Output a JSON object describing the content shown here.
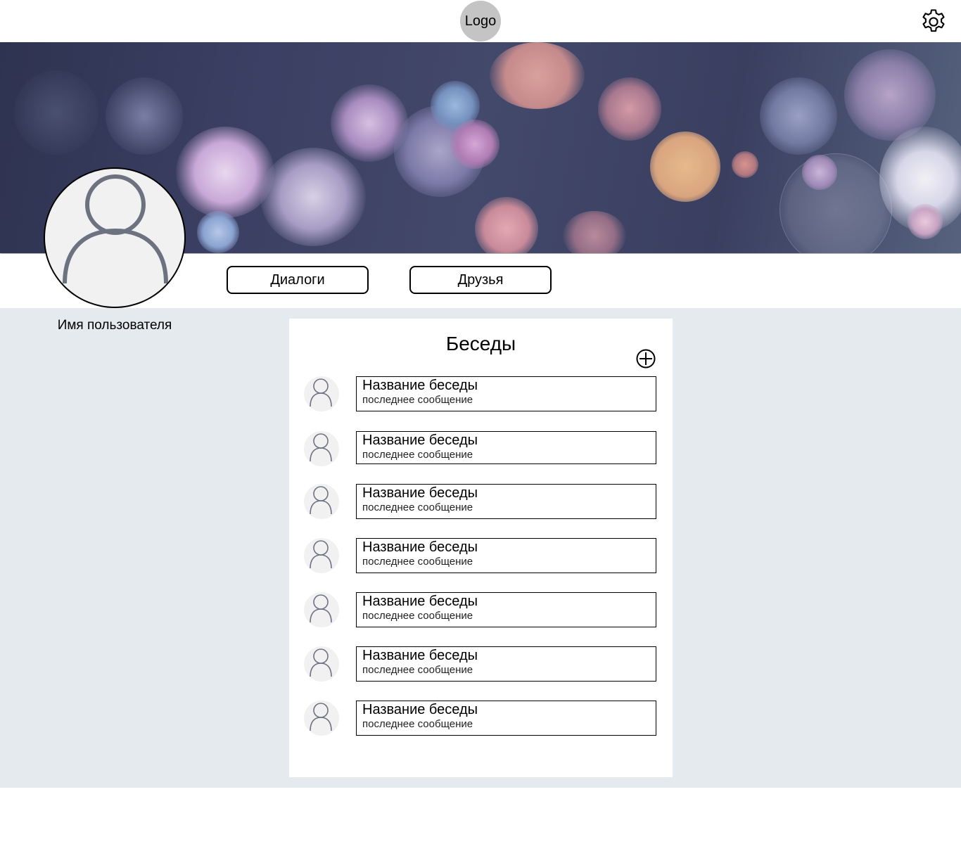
{
  "header": {
    "logo_text": "Logo",
    "settings_icon": "gear-icon"
  },
  "profile": {
    "username": "Имя пользователя",
    "avatar_icon": "user-icon"
  },
  "nav": {
    "dialogs_label": "Диалоги",
    "friends_label": "Друзья"
  },
  "conversations": {
    "title": "Беседы",
    "add_icon": "plus-circle-icon",
    "items": [
      {
        "name": "Название беседы",
        "last_message": "последнее сообщение"
      },
      {
        "name": "Название беседы",
        "last_message": "последнее сообщение"
      },
      {
        "name": "Название беседы",
        "last_message": "последнее сообщение"
      },
      {
        "name": "Название беседы",
        "last_message": "последнее сообщение"
      },
      {
        "name": "Название беседы",
        "last_message": "последнее сообщение"
      },
      {
        "name": "Название беседы",
        "last_message": "последнее сообщение"
      },
      {
        "name": "Название беседы",
        "last_message": "последнее сообщение"
      }
    ]
  },
  "colors": {
    "page_background": "#e5eaee",
    "panel_background": "#ffffff",
    "logo_background": "#c4c4c4",
    "avatar_background": "#f1f1f1",
    "avatar_stroke": "#6d7280"
  }
}
